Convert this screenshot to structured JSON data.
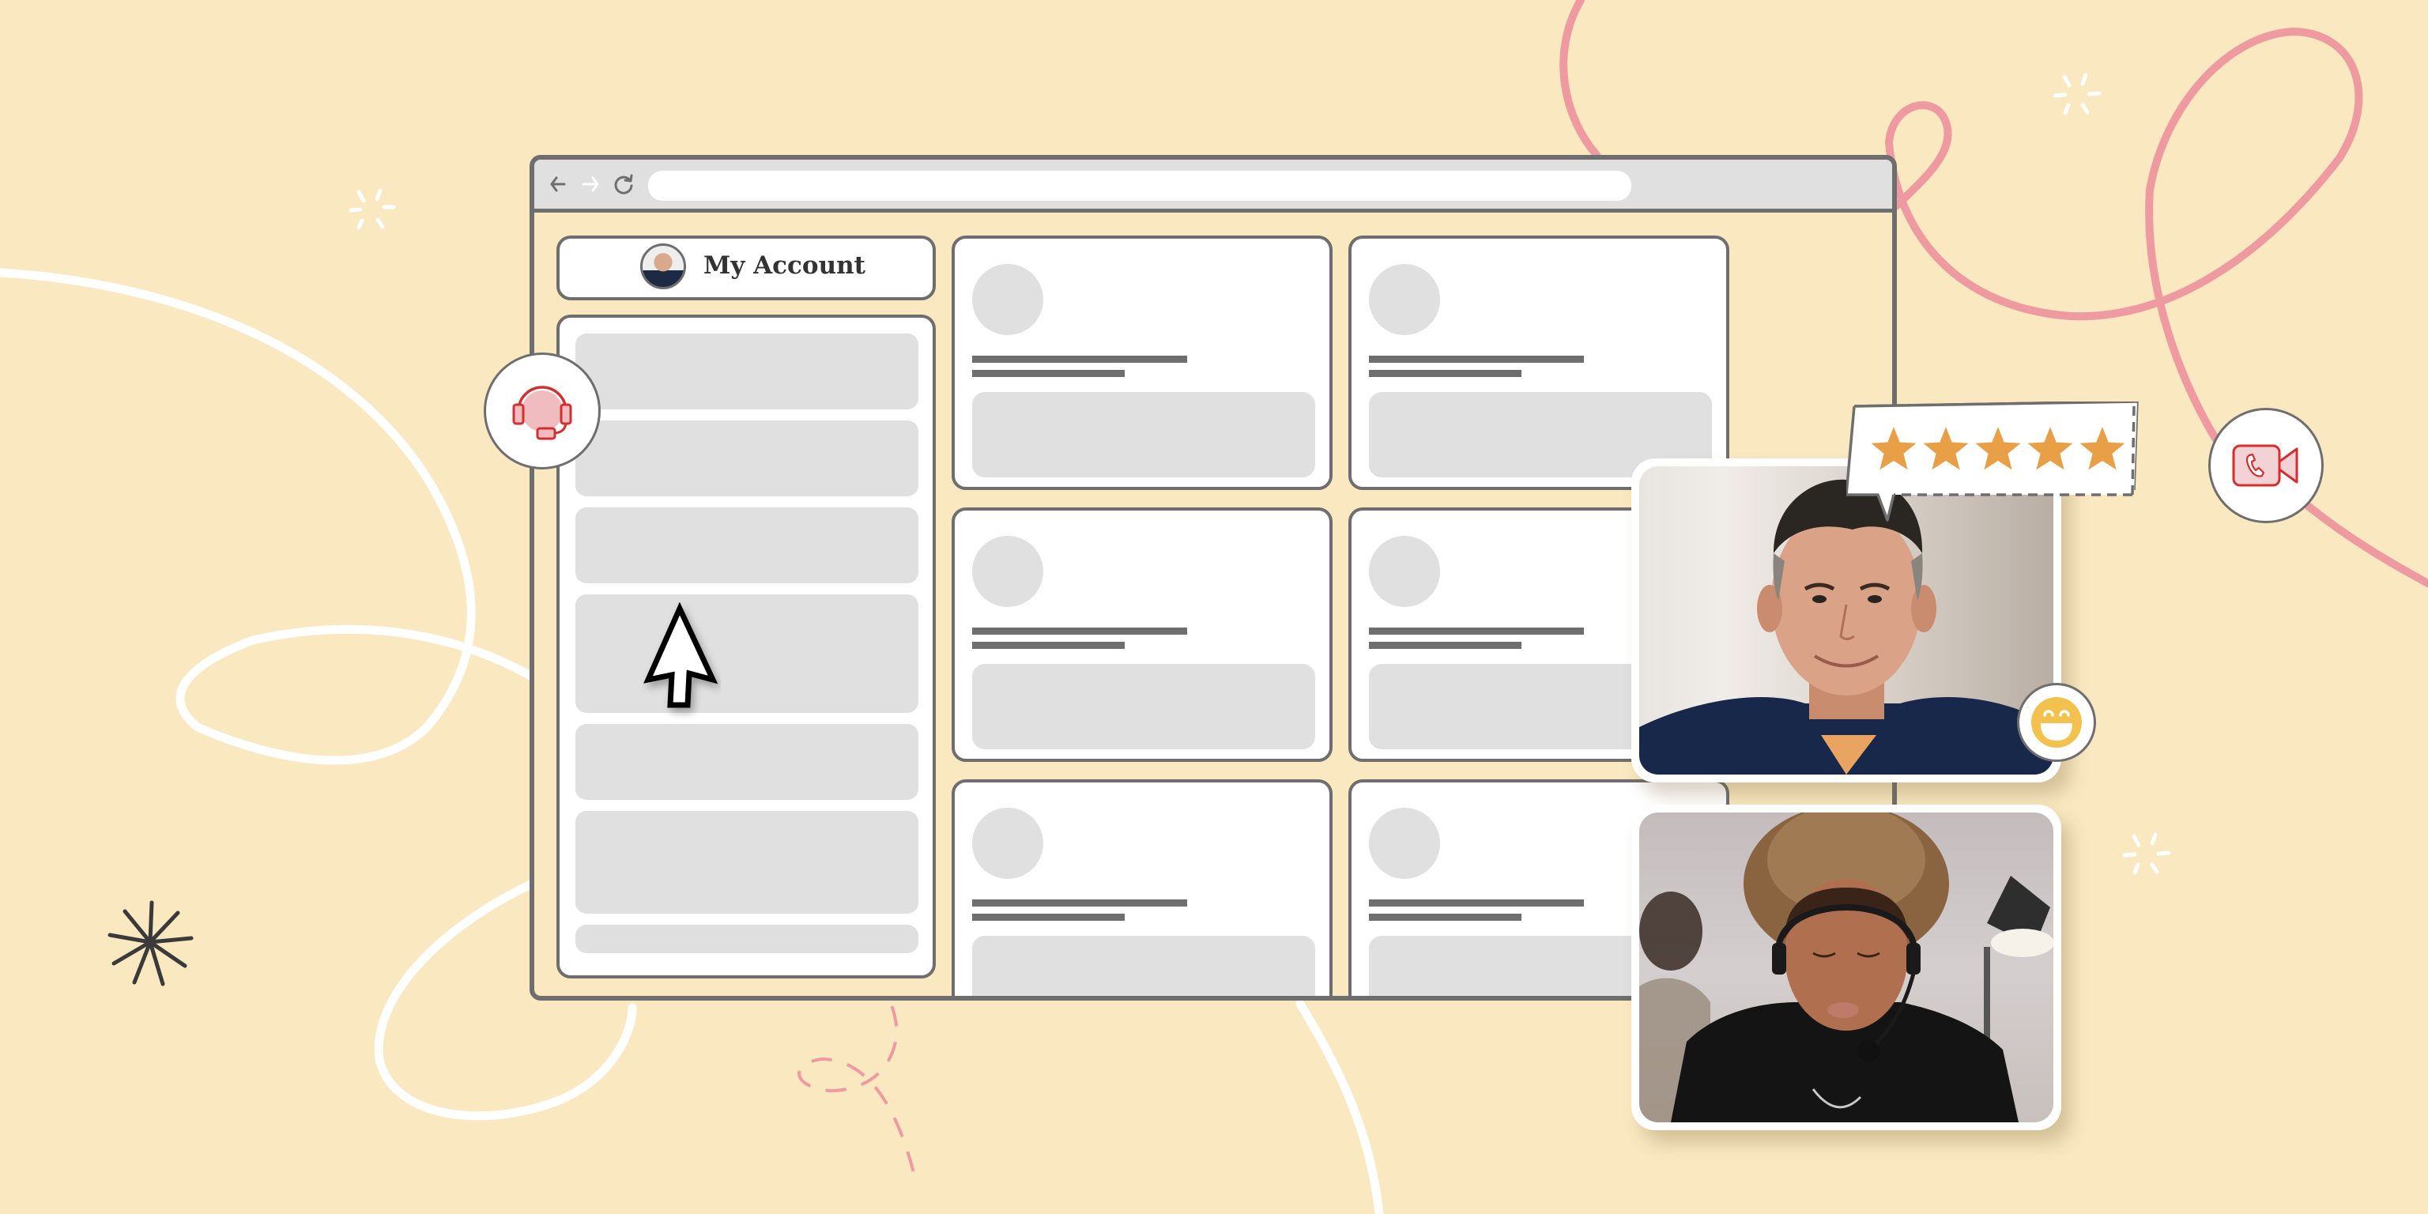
{
  "browser": {
    "nav": {
      "back_icon": "arrow-left-icon",
      "forward_icon": "arrow-right-icon",
      "reload_icon": "reload-icon"
    },
    "url": ""
  },
  "account": {
    "label": "My Account",
    "avatar_icon": "user-avatar"
  },
  "sidebar": {
    "items": [
      {
        "label": ""
      },
      {
        "label": ""
      },
      {
        "label": ""
      },
      {
        "label": ""
      },
      {
        "label": ""
      },
      {
        "label": ""
      },
      {
        "label": ""
      }
    ]
  },
  "cards": [
    {
      "title": "",
      "subtitle": ""
    },
    {
      "title": "",
      "subtitle": ""
    },
    {
      "title": "",
      "subtitle": ""
    },
    {
      "title": "",
      "subtitle": ""
    },
    {
      "title": "",
      "subtitle": ""
    },
    {
      "title": "",
      "subtitle": ""
    }
  ],
  "floating_icons": {
    "support": "headset-icon",
    "video_call": "video-call-icon",
    "emoji": "grinning-face-icon"
  },
  "rating": {
    "stars": 5,
    "max": 5,
    "star_color": "#e89f45"
  },
  "photos": [
    {
      "subject": "smiling man in navy jacket"
    },
    {
      "subject": "support agent wearing headset"
    }
  ],
  "colors": {
    "background": "#f9e8c0",
    "outline": "#6e6e6e",
    "placeholder": "#e0e0e0",
    "accent_red": "#d42e2e",
    "accent_pink": "#ee9aa0",
    "emoji_yellow": "#f2c14e"
  }
}
